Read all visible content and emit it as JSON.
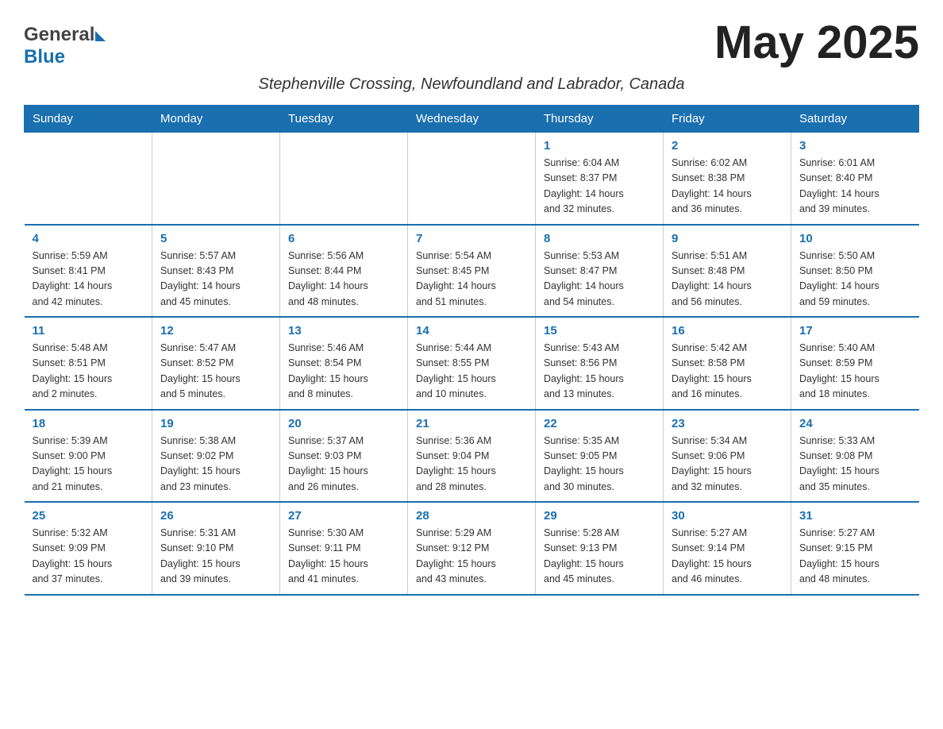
{
  "header": {
    "logo_general": "General",
    "logo_blue": "Blue",
    "month_title": "May 2025",
    "subtitle": "Stephenville Crossing, Newfoundland and Labrador, Canada"
  },
  "days_of_week": [
    "Sunday",
    "Monday",
    "Tuesday",
    "Wednesday",
    "Thursday",
    "Friday",
    "Saturday"
  ],
  "weeks": [
    [
      {
        "day": "",
        "info": ""
      },
      {
        "day": "",
        "info": ""
      },
      {
        "day": "",
        "info": ""
      },
      {
        "day": "",
        "info": ""
      },
      {
        "day": "1",
        "info": "Sunrise: 6:04 AM\nSunset: 8:37 PM\nDaylight: 14 hours\nand 32 minutes."
      },
      {
        "day": "2",
        "info": "Sunrise: 6:02 AM\nSunset: 8:38 PM\nDaylight: 14 hours\nand 36 minutes."
      },
      {
        "day": "3",
        "info": "Sunrise: 6:01 AM\nSunset: 8:40 PM\nDaylight: 14 hours\nand 39 minutes."
      }
    ],
    [
      {
        "day": "4",
        "info": "Sunrise: 5:59 AM\nSunset: 8:41 PM\nDaylight: 14 hours\nand 42 minutes."
      },
      {
        "day": "5",
        "info": "Sunrise: 5:57 AM\nSunset: 8:43 PM\nDaylight: 14 hours\nand 45 minutes."
      },
      {
        "day": "6",
        "info": "Sunrise: 5:56 AM\nSunset: 8:44 PM\nDaylight: 14 hours\nand 48 minutes."
      },
      {
        "day": "7",
        "info": "Sunrise: 5:54 AM\nSunset: 8:45 PM\nDaylight: 14 hours\nand 51 minutes."
      },
      {
        "day": "8",
        "info": "Sunrise: 5:53 AM\nSunset: 8:47 PM\nDaylight: 14 hours\nand 54 minutes."
      },
      {
        "day": "9",
        "info": "Sunrise: 5:51 AM\nSunset: 8:48 PM\nDaylight: 14 hours\nand 56 minutes."
      },
      {
        "day": "10",
        "info": "Sunrise: 5:50 AM\nSunset: 8:50 PM\nDaylight: 14 hours\nand 59 minutes."
      }
    ],
    [
      {
        "day": "11",
        "info": "Sunrise: 5:48 AM\nSunset: 8:51 PM\nDaylight: 15 hours\nand 2 minutes."
      },
      {
        "day": "12",
        "info": "Sunrise: 5:47 AM\nSunset: 8:52 PM\nDaylight: 15 hours\nand 5 minutes."
      },
      {
        "day": "13",
        "info": "Sunrise: 5:46 AM\nSunset: 8:54 PM\nDaylight: 15 hours\nand 8 minutes."
      },
      {
        "day": "14",
        "info": "Sunrise: 5:44 AM\nSunset: 8:55 PM\nDaylight: 15 hours\nand 10 minutes."
      },
      {
        "day": "15",
        "info": "Sunrise: 5:43 AM\nSunset: 8:56 PM\nDaylight: 15 hours\nand 13 minutes."
      },
      {
        "day": "16",
        "info": "Sunrise: 5:42 AM\nSunset: 8:58 PM\nDaylight: 15 hours\nand 16 minutes."
      },
      {
        "day": "17",
        "info": "Sunrise: 5:40 AM\nSunset: 8:59 PM\nDaylight: 15 hours\nand 18 minutes."
      }
    ],
    [
      {
        "day": "18",
        "info": "Sunrise: 5:39 AM\nSunset: 9:00 PM\nDaylight: 15 hours\nand 21 minutes."
      },
      {
        "day": "19",
        "info": "Sunrise: 5:38 AM\nSunset: 9:02 PM\nDaylight: 15 hours\nand 23 minutes."
      },
      {
        "day": "20",
        "info": "Sunrise: 5:37 AM\nSunset: 9:03 PM\nDaylight: 15 hours\nand 26 minutes."
      },
      {
        "day": "21",
        "info": "Sunrise: 5:36 AM\nSunset: 9:04 PM\nDaylight: 15 hours\nand 28 minutes."
      },
      {
        "day": "22",
        "info": "Sunrise: 5:35 AM\nSunset: 9:05 PM\nDaylight: 15 hours\nand 30 minutes."
      },
      {
        "day": "23",
        "info": "Sunrise: 5:34 AM\nSunset: 9:06 PM\nDaylight: 15 hours\nand 32 minutes."
      },
      {
        "day": "24",
        "info": "Sunrise: 5:33 AM\nSunset: 9:08 PM\nDaylight: 15 hours\nand 35 minutes."
      }
    ],
    [
      {
        "day": "25",
        "info": "Sunrise: 5:32 AM\nSunset: 9:09 PM\nDaylight: 15 hours\nand 37 minutes."
      },
      {
        "day": "26",
        "info": "Sunrise: 5:31 AM\nSunset: 9:10 PM\nDaylight: 15 hours\nand 39 minutes."
      },
      {
        "day": "27",
        "info": "Sunrise: 5:30 AM\nSunset: 9:11 PM\nDaylight: 15 hours\nand 41 minutes."
      },
      {
        "day": "28",
        "info": "Sunrise: 5:29 AM\nSunset: 9:12 PM\nDaylight: 15 hours\nand 43 minutes."
      },
      {
        "day": "29",
        "info": "Sunrise: 5:28 AM\nSunset: 9:13 PM\nDaylight: 15 hours\nand 45 minutes."
      },
      {
        "day": "30",
        "info": "Sunrise: 5:27 AM\nSunset: 9:14 PM\nDaylight: 15 hours\nand 46 minutes."
      },
      {
        "day": "31",
        "info": "Sunrise: 5:27 AM\nSunset: 9:15 PM\nDaylight: 15 hours\nand 48 minutes."
      }
    ]
  ]
}
